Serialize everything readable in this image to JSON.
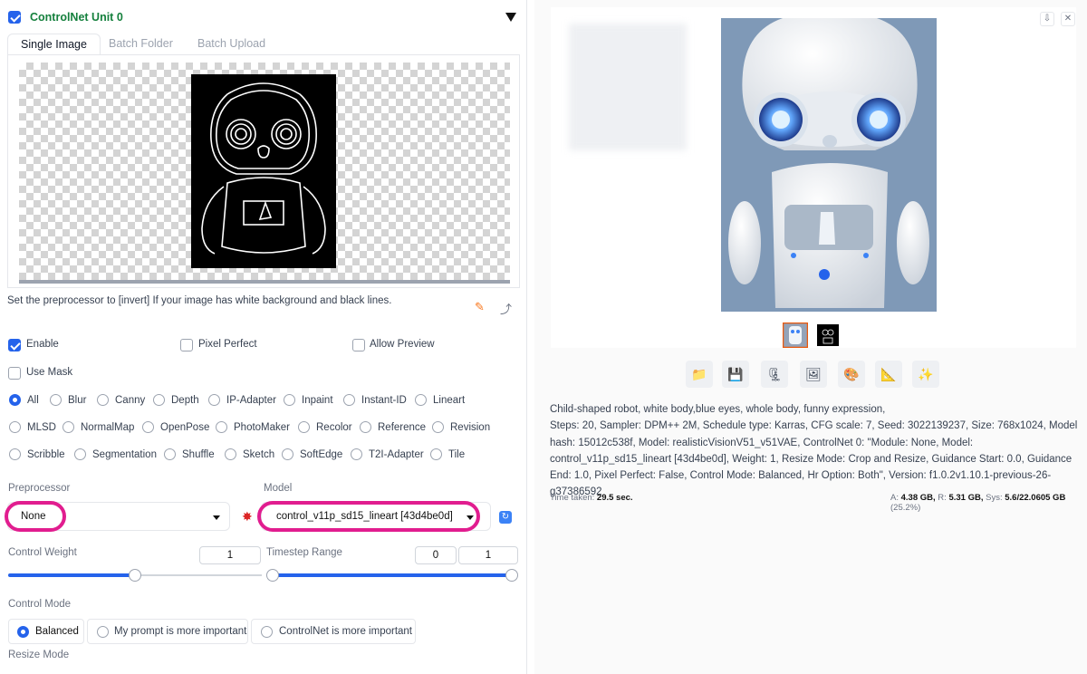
{
  "unit": {
    "title": "ControlNet Unit 0",
    "enabled": true
  },
  "tabs": [
    "Single Image",
    "Batch Folder",
    "Batch Upload"
  ],
  "note": "Set the preprocessor to [invert] If your image has white background and black lines.",
  "options": {
    "enable": "Enable",
    "pixel_perfect": "Pixel Perfect",
    "allow_preview": "Allow Preview",
    "use_mask": "Use Mask"
  },
  "control_types": {
    "row1": [
      "All",
      "Blur",
      "Canny",
      "Depth",
      "IP-Adapter",
      "Inpaint",
      "Instant-ID",
      "Lineart"
    ],
    "row2": [
      "MLSD",
      "NormalMap",
      "OpenPose",
      "PhotoMaker",
      "Recolor",
      "Reference",
      "Revision"
    ],
    "row3": [
      "Scribble",
      "Segmentation",
      "Shuffle",
      "Sketch",
      "SoftEdge",
      "T2I-Adapter",
      "Tile"
    ],
    "selected": "All"
  },
  "preprocessor": {
    "label": "Preprocessor",
    "value": "None"
  },
  "model": {
    "label": "Model",
    "value": "control_v11p_sd15_lineart [43d4be0d]"
  },
  "control_weight": {
    "label": "Control Weight",
    "value": "1",
    "fraction": 0.5
  },
  "timestep": {
    "label": "Timestep Range",
    "start": "0",
    "end": "1"
  },
  "control_mode": {
    "label": "Control Mode",
    "options": [
      "Balanced",
      "My prompt is more important",
      "ControlNet is more important"
    ],
    "selected": "Balanced"
  },
  "resize_mode": {
    "label": "Resize Mode"
  },
  "result": {
    "tool_icons": [
      "folder-icon",
      "save-icon",
      "zip-icon",
      "image-icon",
      "palette-icon",
      "ruler-icon",
      "sparkle-icon"
    ],
    "info_prompt": "Child-shaped robot, white body,blue eyes, whole body, funny expression,",
    "info_params": "Steps: 20, Sampler: DPM++ 2M, Schedule type: Karras, CFG scale: 7, Seed: 3022139237, Size: 768x1024, Model hash: 15012c538f, Model: realisticVisionV51_v51VAE, ControlNet 0: \"Module: None, Model: control_v11p_sd15_lineart [43d4be0d], Weight: 1, Resize Mode: Crop and Resize, Guidance Start: 0.0, Guidance End: 1.0, Pixel Perfect: False, Control Mode: Balanced, Hr Option: Both\", Version: f1.0.2v1.10.1-previous-26-g37386592",
    "time_label": "Time taken:",
    "time_value": "29.5 sec.",
    "mem_a_label": "A:",
    "mem_a": "4.38 GB,",
    "mem_r_label": "R:",
    "mem_r": "5.31 GB,",
    "mem_sys_label": "Sys:",
    "mem_sys": "5.6/22.0605 GB",
    "mem_pct": "(25.2%)"
  }
}
